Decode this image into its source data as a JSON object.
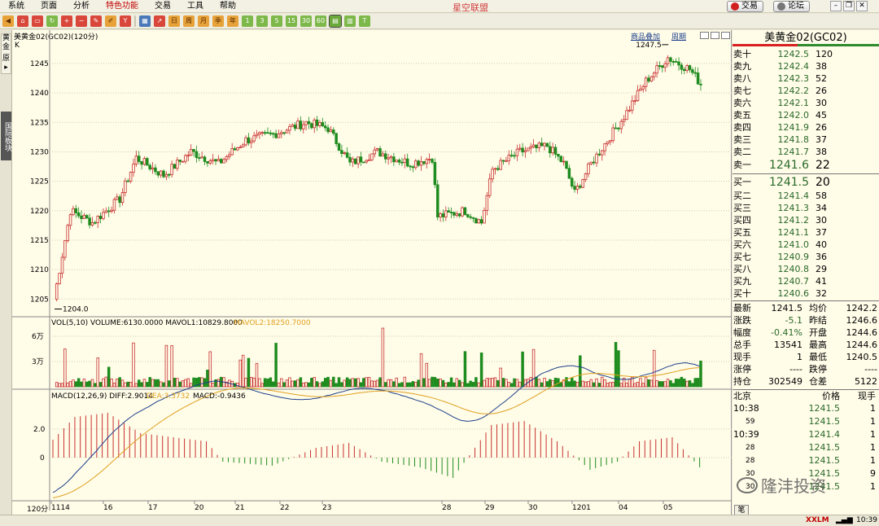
{
  "menu": {
    "items": [
      "系统",
      "页面",
      "分析",
      "特色功能",
      "交易",
      "工具",
      "帮助"
    ],
    "center_title": "星空联盟",
    "trade_button": "交易",
    "forum_button": "论坛"
  },
  "toolbar": {
    "period_buttons": [
      "日",
      "周",
      "月",
      "季",
      "年",
      "1",
      "3",
      "5",
      "15",
      "30",
      "60"
    ]
  },
  "left_tabs": {
    "gold": "黄金",
    "source": "原",
    "intl": "国际板块"
  },
  "chart": {
    "title": "美黄金02(GC02)(120分)",
    "k_label": "K",
    "link_overlay": "商品叠加",
    "link_period": "周期",
    "price_ticks": [
      "1245",
      "1240",
      "1235",
      "1230",
      "1225",
      "1220",
      "1215",
      "1210",
      "1205"
    ],
    "high_label": "1247.5",
    "low_label": "1204.0",
    "vol_label": "VOL(5,10)  VOLUME:6130.0000  MAVOL1:10829.8000",
    "vol_label2": "MAVOL2:18250.7000",
    "vol_ticks": [
      "6万",
      "3万"
    ],
    "macd_label": "MACD(12,26,9)  DIFF:2.9014",
    "macd_dea": "DEA:3.3732",
    "macd_val": "MACD:-0.9436",
    "macd_ticks": [
      "2.0",
      "0"
    ],
    "x_ticks": [
      "1114",
      "16",
      "17",
      "20",
      "21",
      "22",
      "23",
      "28",
      "29",
      "30",
      "1201",
      "04",
      "05"
    ],
    "period_label": "120分"
  },
  "quote": {
    "title": "美黄金02(GC02)",
    "asks": [
      {
        "label": "卖十",
        "price": "1242.5",
        "vol": "120"
      },
      {
        "label": "卖九",
        "price": "1242.4",
        "vol": "38"
      },
      {
        "label": "卖八",
        "price": "1242.3",
        "vol": "52"
      },
      {
        "label": "卖七",
        "price": "1242.2",
        "vol": "26"
      },
      {
        "label": "卖六",
        "price": "1242.1",
        "vol": "30"
      },
      {
        "label": "卖五",
        "price": "1242.0",
        "vol": "45"
      },
      {
        "label": "卖四",
        "price": "1241.9",
        "vol": "26"
      },
      {
        "label": "卖三",
        "price": "1241.8",
        "vol": "37"
      },
      {
        "label": "卖二",
        "price": "1241.7",
        "vol": "38"
      },
      {
        "label": "卖一",
        "price": "1241.6",
        "vol": "22"
      }
    ],
    "bids": [
      {
        "label": "买一",
        "price": "1241.5",
        "vol": "20"
      },
      {
        "label": "买二",
        "price": "1241.4",
        "vol": "58"
      },
      {
        "label": "买三",
        "price": "1241.3",
        "vol": "34"
      },
      {
        "label": "买四",
        "price": "1241.2",
        "vol": "30"
      },
      {
        "label": "买五",
        "price": "1241.1",
        "vol": "37"
      },
      {
        "label": "买六",
        "price": "1241.0",
        "vol": "40"
      },
      {
        "label": "买七",
        "price": "1240.9",
        "vol": "36"
      },
      {
        "label": "买八",
        "price": "1240.8",
        "vol": "29"
      },
      {
        "label": "买九",
        "price": "1240.7",
        "vol": "41"
      },
      {
        "label": "买十",
        "price": "1240.6",
        "vol": "32"
      }
    ],
    "stats": [
      {
        "l1": "最新",
        "v1": "1241.5",
        "l2": "均价",
        "v2": "1242.2"
      },
      {
        "l1": "涨跌",
        "v1": "-5.1",
        "l2": "昨结",
        "v2": "1246.6"
      },
      {
        "l1": "幅度",
        "v1": "-0.41%",
        "l2": "开盘",
        "v2": "1244.6"
      },
      {
        "l1": "总手",
        "v1": "13541",
        "l2": "最高",
        "v2": "1244.6"
      },
      {
        "l1": "现手",
        "v1": "1",
        "l2": "最低",
        "v2": "1240.5"
      },
      {
        "l1": "涨停",
        "v1": "----",
        "l2": "跌停",
        "v2": "----"
      },
      {
        "l1": "持仓",
        "v1": "302549",
        "l2": "仓差",
        "v2": "5122"
      }
    ],
    "ticks_header": {
      "city": "北京",
      "price": "价格",
      "qty": "现手"
    },
    "ticks": [
      {
        "time": "10:38",
        "price": "1241.5",
        "qty": "1"
      },
      {
        "time": "59",
        "price": "1241.5",
        "qty": "1"
      },
      {
        "time": "10:39",
        "price": "1241.4",
        "qty": "1"
      },
      {
        "time": "28",
        "price": "1241.5",
        "qty": "1"
      },
      {
        "time": "28",
        "price": "1241.5",
        "qty": "1"
      },
      {
        "time": "30",
        "price": "1241.5",
        "qty": "9"
      },
      {
        "time": "30",
        "price": "1241.5",
        "qty": "1"
      }
    ],
    "bottom_tab": "笔"
  },
  "watermark": "隆沣投资",
  "status": {
    "brand": "XXLM",
    "time": "10:39"
  },
  "colors": {
    "up": "#C83030",
    "down": "#1E8C1E",
    "diff": "#1C3F8C",
    "dea": "#E0A020",
    "bg": "#FFFCE8"
  }
}
